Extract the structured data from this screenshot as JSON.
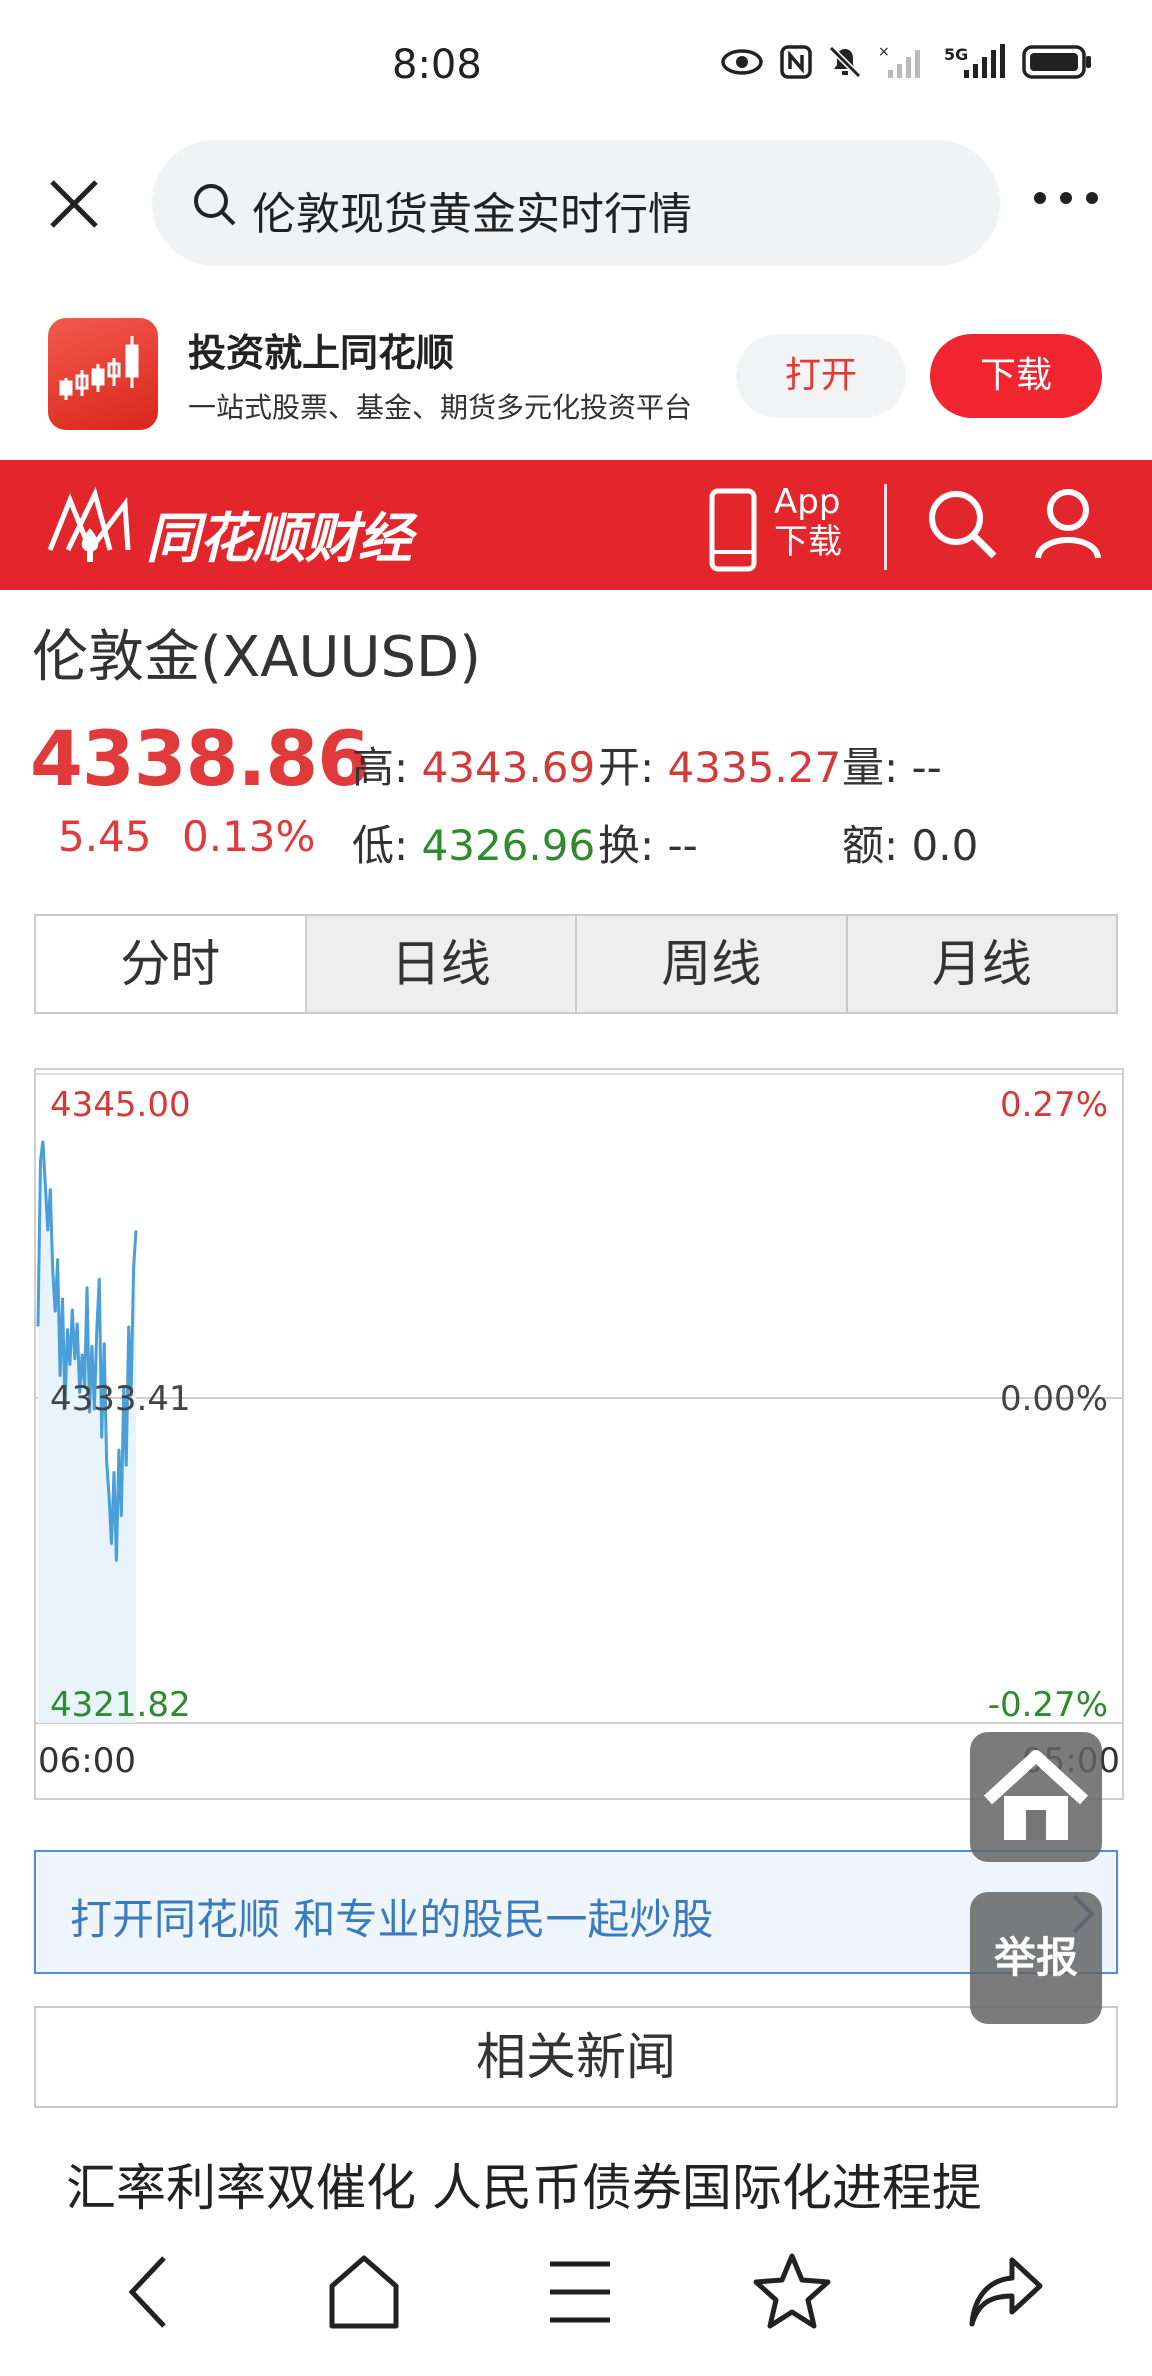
{
  "status_bar": {
    "time": "8:08",
    "icons": [
      "eye-icon",
      "nfc-icon",
      "mute-icon",
      "signal-no-sim-icon",
      "5g-signal-icon",
      "battery-icon"
    ],
    "network_label": "5G"
  },
  "search": {
    "query": "伦敦现货黄金实时行情"
  },
  "promo": {
    "title": "投资就上同花顺",
    "subtitle": "一站式股票、基金、期货多元化投资平台",
    "open_label": "打开",
    "download_label": "下载"
  },
  "header": {
    "brand": "同花顺财经",
    "app_download_line1": "App",
    "app_download_line2": "下载",
    "accent_color": "#e2262c"
  },
  "quote": {
    "title": "伦敦金(XAUUSD)",
    "price": "4338.86",
    "change": "5.45",
    "change_pct": "0.13%",
    "high_label": "高:",
    "high": "4343.69",
    "open_label": "开:",
    "open": "4335.27",
    "volume_label": "量:",
    "volume": "--",
    "low_label": "低:",
    "low": "4326.96",
    "turnover_rate_label": "换:",
    "turnover_rate": "--",
    "amount_label": "额:",
    "amount": "0.0"
  },
  "tabs": [
    {
      "label": "分时",
      "active": true
    },
    {
      "label": "日线",
      "active": false
    },
    {
      "label": "周线",
      "active": false
    },
    {
      "label": "月线",
      "active": false
    }
  ],
  "chart_data": {
    "type": "line",
    "title": "",
    "y_left_ticks": [
      "4345.00",
      "4333.41",
      "4321.82"
    ],
    "y_right_ticks": [
      "0.27%",
      "0.00%",
      "-0.27%"
    ],
    "x_ticks": [
      "06:00",
      "05:00"
    ],
    "ylim": [
      4321.82,
      4345.0
    ],
    "prev_close": 4333.41,
    "series": [
      {
        "values": [
          4336.0,
          4341.9,
          4342.6,
          4341.0,
          4339.4,
          4340.9,
          4338.0,
          4336.5,
          4338.4,
          4334.2,
          4337.0,
          4333.1,
          4335.9,
          4334.6,
          4336.6,
          4334.8,
          4336.1,
          4333.6,
          4335.0,
          4333.8,
          4337.4,
          4332.9,
          4335.3,
          4333.0,
          4335.9,
          4337.7,
          4332.0,
          4335.4,
          4331.2,
          4329.9,
          4328.2,
          4330.8,
          4327.6,
          4331.6,
          4329.2,
          4333.8,
          4331.0,
          4336.0,
          4333.5,
          4338.1,
          4339.4
        ]
      }
    ],
    "line_color": "#4a9fd8",
    "fill_color": "#e8f3fc",
    "up_color": "#d33a3a",
    "down_color": "#2e8b2e"
  },
  "open_app_bar": {
    "text": "打开同花顺 和专业的股民一起炒股"
  },
  "floating": {
    "report_label": "举报"
  },
  "news": {
    "header": "相关新闻",
    "first_item": "汇率利率双催化 人民币债券国际化进程提"
  }
}
